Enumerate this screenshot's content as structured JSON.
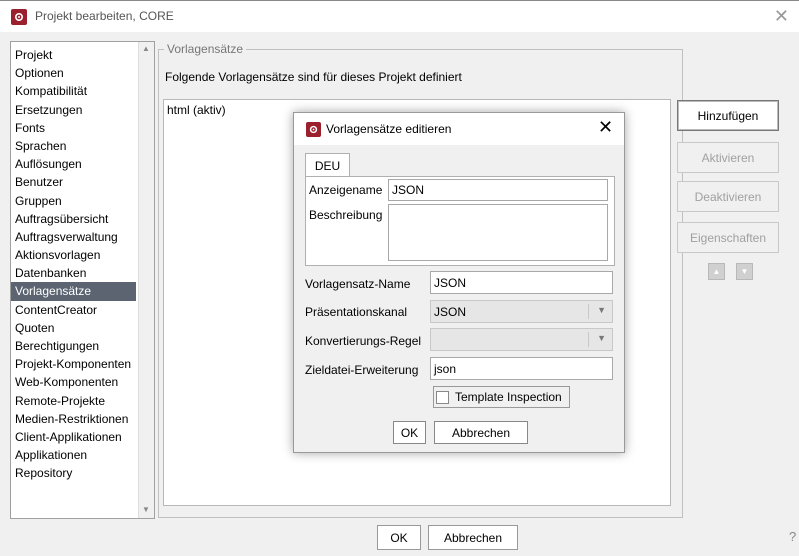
{
  "window": {
    "title": "Projekt bearbeiten, CORE",
    "close_glyph": "✕"
  },
  "sidebar": {
    "items": [
      {
        "label": "Projekt"
      },
      {
        "label": "Optionen"
      },
      {
        "label": "Kompatibilität"
      },
      {
        "label": "Ersetzungen"
      },
      {
        "label": "Fonts"
      },
      {
        "label": "Sprachen"
      },
      {
        "label": "Auflösungen"
      },
      {
        "label": "Benutzer"
      },
      {
        "label": "Gruppen"
      },
      {
        "label": "Auftragsübersicht"
      },
      {
        "label": "Auftragsverwaltung"
      },
      {
        "label": "Aktionsvorlagen"
      },
      {
        "label": "Datenbanken"
      },
      {
        "label": "Vorlagensätze",
        "selected": true
      },
      {
        "label": "ContentCreator"
      },
      {
        "label": "Quoten"
      },
      {
        "label": "Berechtigungen"
      },
      {
        "label": "Projekt-Komponenten"
      },
      {
        "label": "Web-Komponenten"
      },
      {
        "label": "Remote-Projekte"
      },
      {
        "label": "Medien-Restriktionen"
      },
      {
        "label": "Client-Applikationen"
      },
      {
        "label": "Applikationen"
      },
      {
        "label": "Repository"
      }
    ]
  },
  "main": {
    "group_label": "Vorlagensätze",
    "description": "Folgende Vorlagensätze sind für dieses Projekt definiert",
    "list_items": [
      "html (aktiv)"
    ],
    "buttons": {
      "add": "Hinzufügen",
      "activate": "Aktivieren",
      "deactivate": "Deaktivieren",
      "properties": "Eigenschaften"
    }
  },
  "footer": {
    "ok": "OK",
    "cancel": "Abbrechen",
    "help": "?"
  },
  "modal": {
    "title": "Vorlagensätze editieren",
    "close_glyph": "✕",
    "tab": "DEU",
    "display_name_label": "Anzeigename",
    "display_name_value": "JSON",
    "description_label": "Beschreibung",
    "description_value": "",
    "name_label": "Vorlagensatz-Name",
    "name_value": "JSON",
    "channel_label": "Präsentationskanal",
    "channel_value": "JSON",
    "conversion_label": "Konvertierungs-Regel",
    "conversion_value": "",
    "extension_label": "Zieldatei-Erweiterung",
    "extension_value": "json",
    "inspection_label": "Template Inspection",
    "inspection_checked": false,
    "ok": "OK",
    "cancel": "Abbrechen"
  },
  "colors": {
    "brand": "#9c1f2e",
    "selection": "#5b6470"
  }
}
